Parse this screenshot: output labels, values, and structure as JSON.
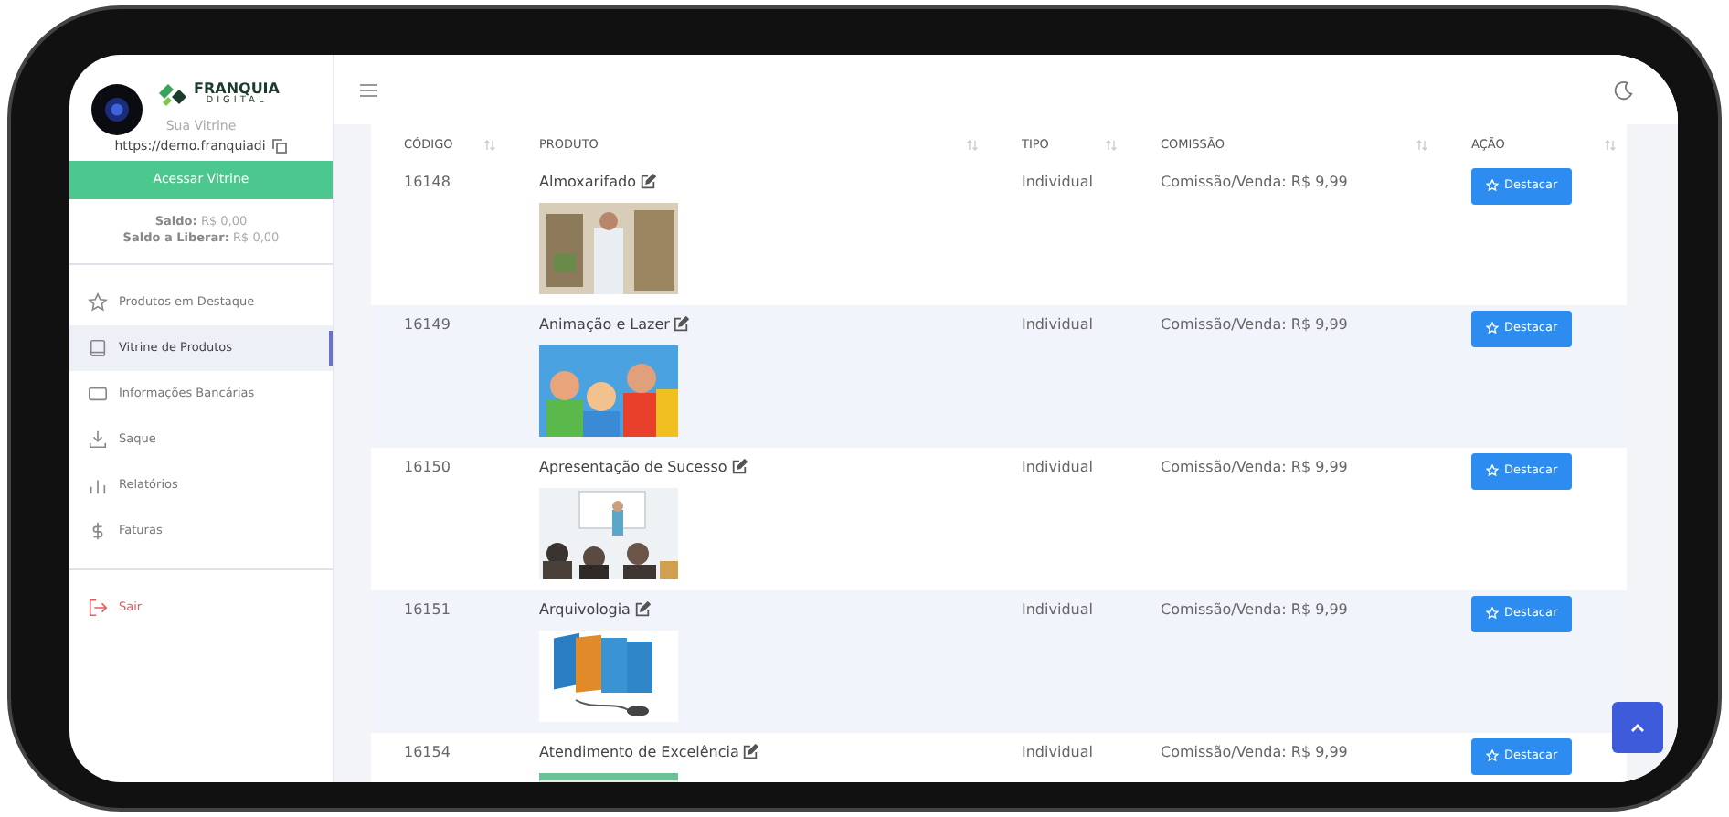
{
  "logo": {
    "line_1": "FRANQUIA",
    "line_2": "DIGITAL"
  },
  "sidebar": {
    "store_label": "Sua Vitrine",
    "store_url": "https://demo.franquiadi",
    "access_button": "Acessar Vitrine",
    "balance": "**Saldo:** R$ 0,00",
    "pending_balance": "**Saldo a Liberar:** R$ 0,00",
    "items": [
      {
        "label": "Produtos em Destaque",
        "selected": false
      },
      {
        "label": "Vitrine de Produtos",
        "selected": true
      },
      {
        "label": "Informações Bancárias",
        "selected": false
      },
      {
        "label": "Saque",
        "selected": false
      },
      {
        "label": "Relatórios",
        "selected": false
      },
      {
        "label": "Faturas",
        "selected": false
      }
    ],
    "logout": "Sair"
  },
  "table": {
    "columns": [
      "CÓDIGO",
      "PRODUTO",
      "TIPO",
      "COMISSÃO",
      "AÇÃO"
    ],
    "rows": [
      {
        "code": "16148",
        "product": "Almoxarifado",
        "type": "Individual",
        "commission": "Comissão/Venda: R$ 9,99",
        "action": "Destacar"
      },
      {
        "code": "16149",
        "product": "Animação e Lazer",
        "type": "Individual",
        "commission": "Comissão/Venda: R$ 9,99",
        "action": "Destacar"
      },
      {
        "code": "16150",
        "product": "Apresentação de Sucesso",
        "type": "Individual",
        "commission": "Comissão/Venda: R$ 9,99",
        "action": "Destacar"
      },
      {
        "code": "16151",
        "product": "Arquivologia",
        "type": "Individual",
        "commission": "Comissão/Venda: R$ 9,99",
        "action": "Destacar"
      },
      {
        "code": "16154",
        "product": "Atendimento de Excelência",
        "type": "Individual",
        "commission": "Comissão/Venda: R$ 9,99",
        "action": "Destacar"
      }
    ]
  }
}
